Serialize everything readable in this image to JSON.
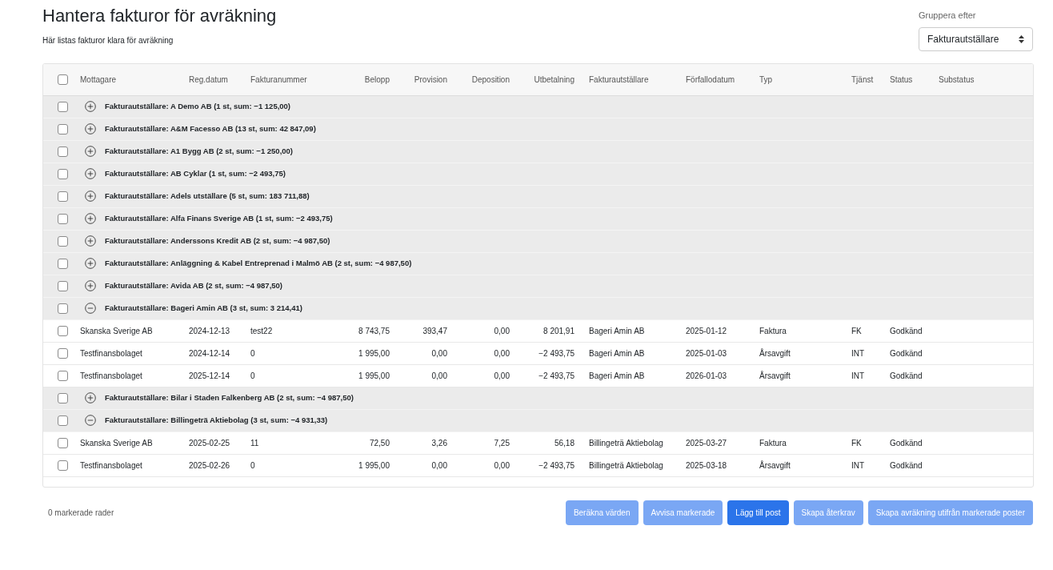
{
  "page": {
    "title": "Hantera fakturor för avräkning",
    "subtitle": "Här listas fakturor klara för avräkning"
  },
  "group_by": {
    "label": "Gruppera efter",
    "value": "Fakturautställare"
  },
  "table": {
    "header_checked": false,
    "columns": [
      "Mottagare",
      "Reg.datum",
      "Fakturanummer",
      "Belopp",
      "Provision",
      "Deposition",
      "Utbetalning",
      "Fakturautställare",
      "Förfallodatum",
      "Typ",
      "Tjänst",
      "Status",
      "Substatus"
    ],
    "groups": [
      {
        "label": "Fakturautställare: A Demo AB (1 st, sum: −1 125,00)",
        "checked": false,
        "expanded": false
      },
      {
        "label": "Fakturautställare: A&M Facesso AB (13 st, sum: 42 847,09)",
        "checked": false,
        "expanded": false
      },
      {
        "label": "Fakturautställare: A1 Bygg AB (2 st, sum: −1 250,00)",
        "checked": false,
        "expanded": false
      },
      {
        "label": "Fakturautställare: AB Cyklar (1 st, sum: −2 493,75)",
        "checked": false,
        "expanded": false
      },
      {
        "label": "Fakturautställare: Adels utställare (5 st, sum: 183 711,88)",
        "checked": false,
        "expanded": false
      },
      {
        "label": "Fakturautställare: Alfa Finans Sverige AB (1 st, sum: −2 493,75)",
        "checked": false,
        "expanded": false
      },
      {
        "label": "Fakturautställare: Anderssons Kredit AB (2 st, sum: −4 987,50)",
        "checked": false,
        "expanded": false
      },
      {
        "label": "Fakturautställare: Anläggning & Kabel Entreprenad i Malmö AB (2 st, sum: −4 987,50)",
        "checked": false,
        "expanded": false
      },
      {
        "label": "Fakturautställare: Avida AB (2 st, sum: −4 987,50)",
        "checked": false,
        "expanded": false
      },
      {
        "label": "Fakturautställare: Bageri Amin AB (3 st, sum: 3 214,41)",
        "checked": false,
        "expanded": true,
        "rows": [
          {
            "checked": false,
            "cells": [
              "Skanska Sverige AB",
              "2024-12-13",
              "test22",
              "8 743,75",
              "393,47",
              "0,00",
              "8 201,91",
              "Bageri Amin AB",
              "2025-01-12",
              "Faktura",
              "FK",
              "Godkänd"
            ]
          },
          {
            "checked": false,
            "cells": [
              "Testfinansbolaget",
              "2024-12-14",
              "0",
              "1 995,00",
              "0,00",
              "0,00",
              "−2 493,75",
              "Bageri Amin AB",
              "2025-01-03",
              "Årsavgift",
              "INT",
              "Godkänd"
            ]
          },
          {
            "checked": false,
            "cells": [
              "Testfinansbolaget",
              "2025-12-14",
              "0",
              "1 995,00",
              "0,00",
              "0,00",
              "−2 493,75",
              "Bageri Amin AB",
              "2026-01-03",
              "Årsavgift",
              "INT",
              "Godkänd"
            ]
          }
        ]
      },
      {
        "label": "Fakturautställare: Bilar i Staden Falkenberg AB (2 st, sum: −4 987,50)",
        "checked": false,
        "expanded": false
      },
      {
        "label": "Fakturautställare: Billingeträ Aktiebolag (3 st, sum: −4 931,33)",
        "checked": false,
        "expanded": true,
        "rows": [
          {
            "checked": false,
            "cells": [
              "Skanska Sverige AB",
              "2025-02-25",
              "11",
              "72,50",
              "3,26",
              "7,25",
              "56,18",
              "Billingeträ Aktiebolag",
              "2025-03-27",
              "Faktura",
              "FK",
              "Godkänd"
            ]
          },
          {
            "checked": false,
            "cells": [
              "Testfinansbolaget",
              "2025-02-26",
              "0",
              "1 995,00",
              "0,00",
              "0,00",
              "−2 493,75",
              "Billingeträ Aktiebolag",
              "2025-03-18",
              "Årsavgift",
              "INT",
              "Godkänd"
            ]
          }
        ]
      }
    ]
  },
  "footer": {
    "selected_count": "0 markerade rader",
    "buttons": [
      {
        "label": "Beräkna värden",
        "disabled": true
      },
      {
        "label": "Avvisa markerade",
        "disabled": true
      },
      {
        "label": "Lägg till post",
        "disabled": false
      },
      {
        "label": "Skapa återkrav",
        "disabled": true
      },
      {
        "label": "Skapa avräkning utifrån markerade poster",
        "disabled": true
      }
    ]
  }
}
